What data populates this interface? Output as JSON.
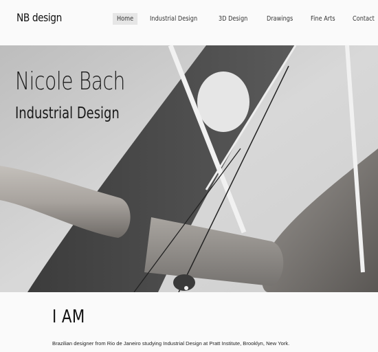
{
  "header": {
    "logo": "NB design",
    "nav": [
      {
        "label": "Home",
        "active": true
      },
      {
        "label": "Industrial Design",
        "active": false
      },
      {
        "label": "3D Design",
        "active": false
      },
      {
        "label": "Drawings",
        "active": false
      },
      {
        "label": "Fine Arts",
        "active": false
      },
      {
        "label": "Contact",
        "active": false
      }
    ]
  },
  "hero": {
    "title": "Nicole Bach",
    "subtitle": "Industrial Design",
    "image_icon": "sculpture-photo"
  },
  "about": {
    "heading": "I AM",
    "text": "Brazilian designer from Rio de Janeiro studying Industrial Design at Pratt Institute, Brooklyn, New York."
  },
  "colors": {
    "background": "#fafafa",
    "active_nav_bg": "#e6e6e6",
    "text": "#111111"
  }
}
